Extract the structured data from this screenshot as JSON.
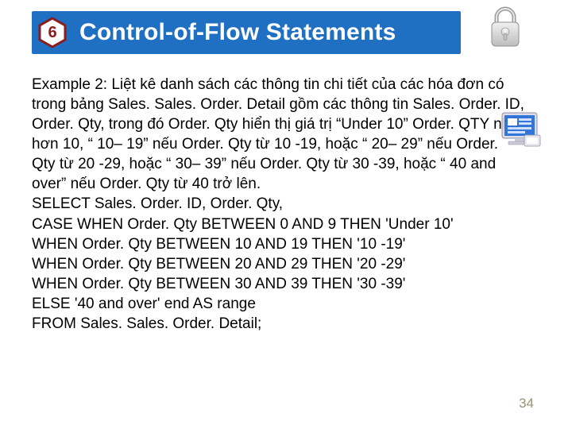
{
  "header": {
    "number": "6",
    "title": "Control-of-Flow Statements"
  },
  "body": {
    "p1": "Example 2: Liệt kê danh sách các thông tin chi tiết của các hóa đơn có trong bảng Sales. Sales. Order. Detail gồm các thông tin Sales. Order. ID, Order. Qty, trong đó Order. Qty hiển thị giá trị “Under 10” Order. QTY nhỏ hơn 10, “ 10– 19” nếu Order. Qty từ 10 -19, hoặc “ 20– 29” nếu Order. Qty từ 20 -29, hoặc “ 30– 39” nếu Order. Qty từ 30 -39, hoặc “ 40 and over” nếu Order. Qty từ 40 trở lên.",
    "l1": "SELECT Sales. Order. ID, Order. Qty,",
    "l2": "CASE WHEN Order. Qty BETWEEN 0 AND 9 THEN 'Under 10'",
    "l3": "WHEN Order. Qty BETWEEN 10 AND 19 THEN '10 -19'",
    "l4": "WHEN Order. Qty BETWEEN 20 AND 29 THEN '20 -29'",
    "l5": "WHEN Order. Qty BETWEEN 30 AND 39 THEN '30 -39'",
    "l6": "ELSE '40 and over' end AS range",
    "l7": "FROM Sales. Sales. Order. Detail;"
  },
  "page_number": "34"
}
